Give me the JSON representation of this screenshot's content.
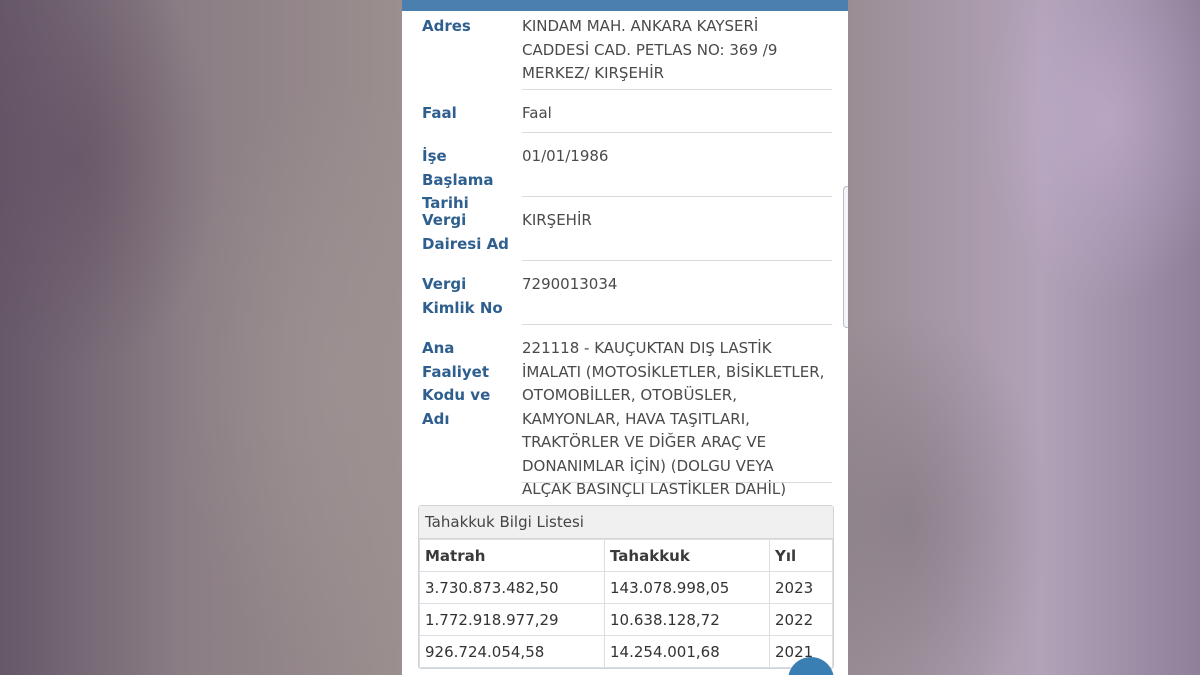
{
  "details": {
    "adres": {
      "label": "Adres",
      "value": "KINDAM MAH. ANKARA KAYSERİ CADDESİ CAD. PETLAS NO: 369 /9 MERKEZ/ KIRŞEHİR"
    },
    "faal": {
      "label": "Faal",
      "value": "Faal"
    },
    "ise_baslama": {
      "label": "İşe Başlama Tarihi",
      "value": "01/01/1986"
    },
    "vergi_dairesi": {
      "label": "Vergi Dairesi Ad",
      "value": "KIRŞEHİR"
    },
    "vergi_kimlik": {
      "label": "Vergi Kimlik No",
      "value": "7290013034"
    },
    "ana_faaliyet": {
      "label": "Ana Faaliyet Kodu ve Adı",
      "value": "221118 - KAUÇUKTAN DIŞ LASTİK İMALATI (MOTOSİKLETLER, BİSİKLETLER, OTOMOBİLLER, OTOBÜSLER, KAMYONLAR, HAVA TAŞITLARI, TRAKTÖRLER VE DİĞER ARAÇ VE DONANIMLAR İÇİN) (DOLGU VEYA ALÇAK BASINÇLI LASTİKLER DAHİL)"
    }
  },
  "tahakkuk": {
    "title": "Tahakkuk Bilgi Listesi",
    "headers": [
      "Matrah",
      "Tahakkuk",
      "Yıl"
    ],
    "rows": [
      [
        "3.730.873.482,50",
        "143.078.998,05",
        "2023"
      ],
      [
        "1.772.918.977,29",
        "10.638.128,72",
        "2022"
      ],
      [
        "926.724.054,58",
        "14.254.001,68",
        "2021"
      ]
    ]
  },
  "colors": {
    "accent": "#2e5f8e",
    "topbar": "#4a7fb0",
    "fab": "#3a7fb3"
  }
}
